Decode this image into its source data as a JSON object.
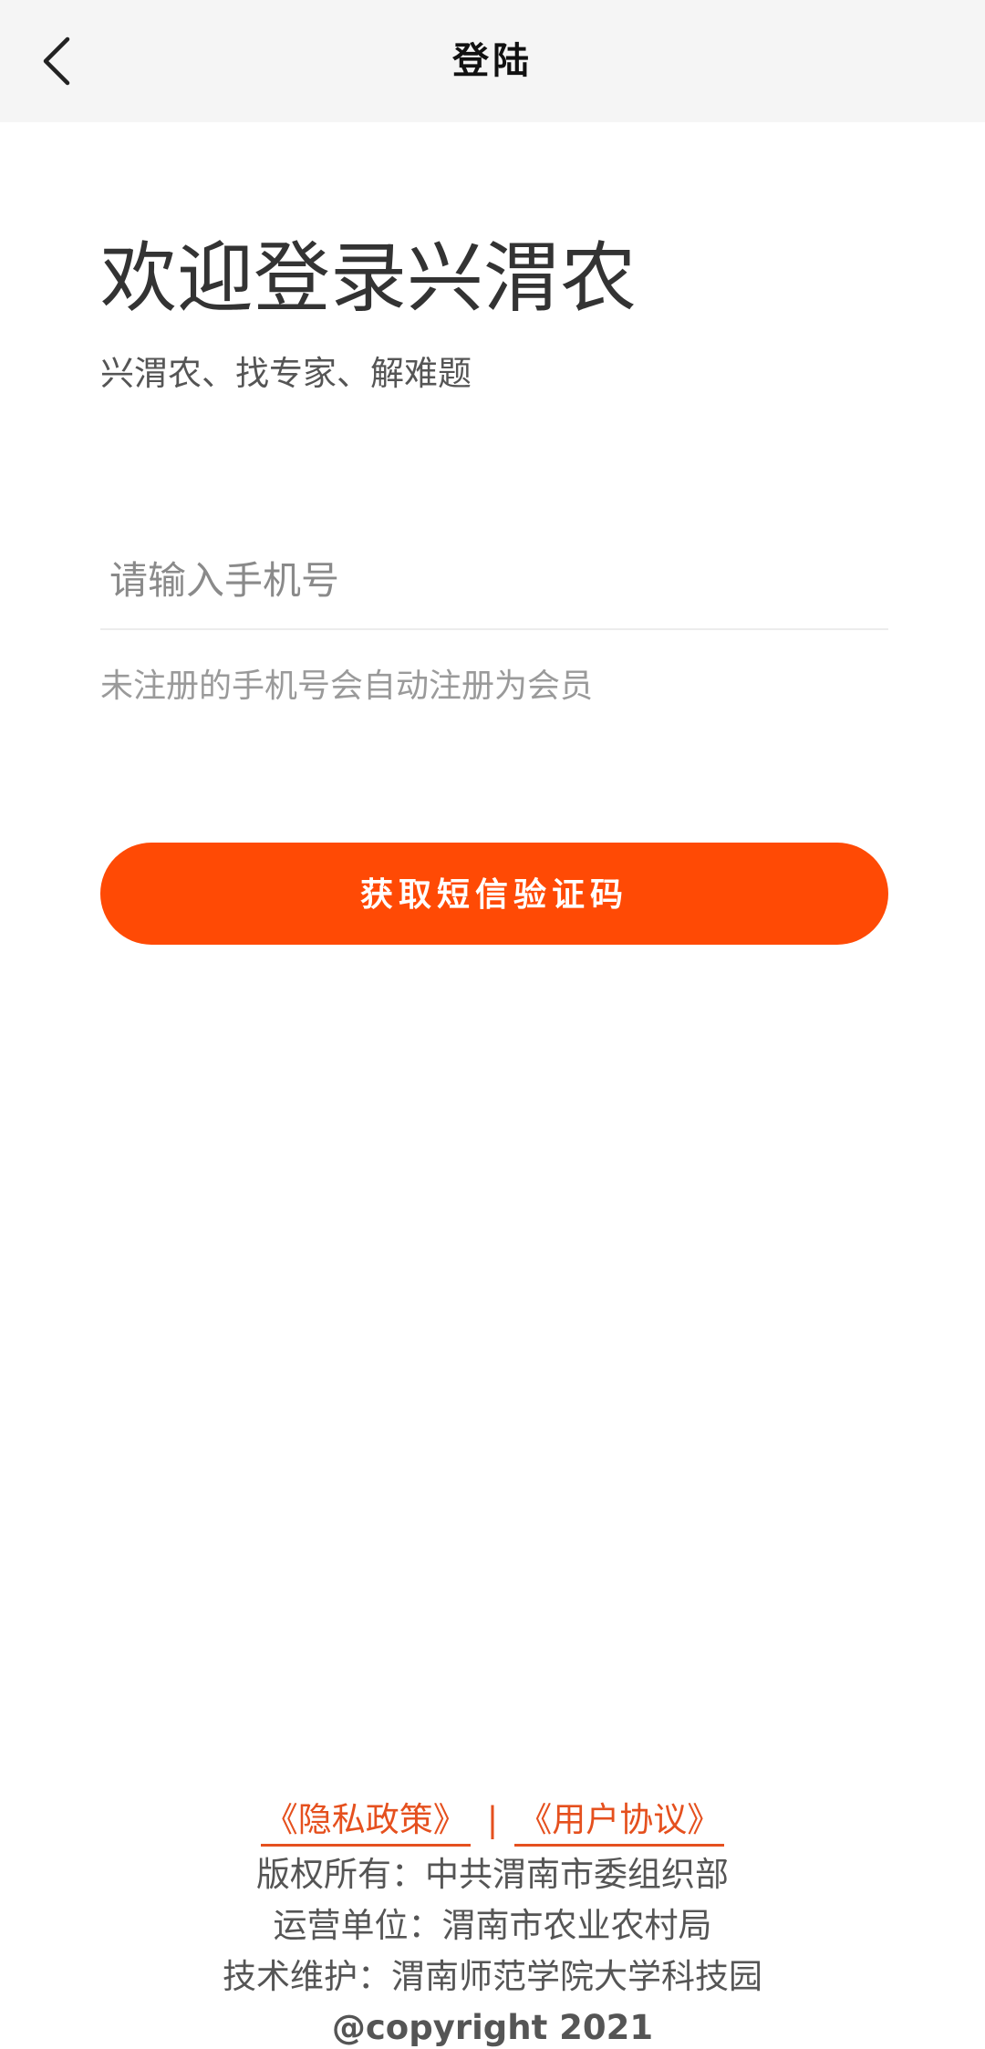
{
  "header": {
    "title": "登陆",
    "back_icon": "chevron-left-icon"
  },
  "welcome": {
    "title": "欢迎登录兴渭农",
    "subtitle": "兴渭农、找专家、解难题"
  },
  "form": {
    "phone_placeholder": "请输入手机号",
    "phone_value": "",
    "hint": "未注册的手机号会自动注册为会员",
    "submit_label": "获取短信验证码"
  },
  "footer": {
    "privacy_link": "《隐私政策》",
    "separator": "|",
    "agreement_link": "《用户协议》",
    "copyright_owner": "版权所有：中共渭南市委组织部",
    "operator": "运营单位：渭南市农业农村局",
    "tech_support": "技术维护：渭南师范学院大学科技园",
    "copyright": "@copyright 2021"
  },
  "colors": {
    "accent": "#ff4a05",
    "link": "#e5501e",
    "header_bg": "#f5f5f5"
  }
}
